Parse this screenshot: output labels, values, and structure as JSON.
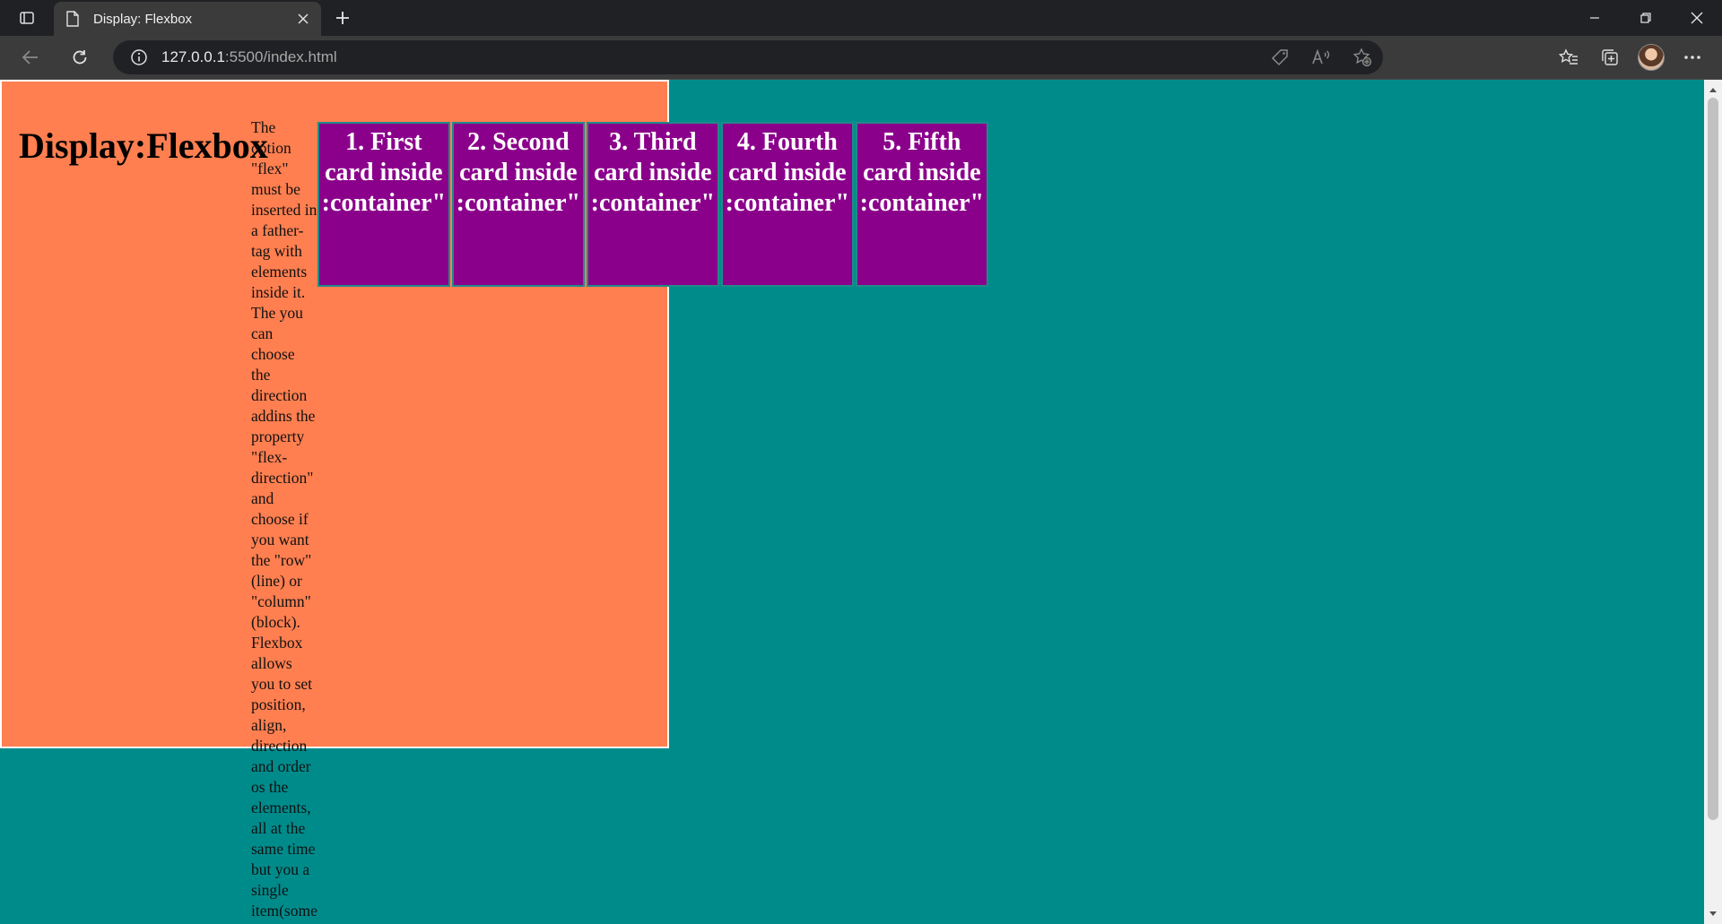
{
  "browser": {
    "tab_title": "Display: Flexbox",
    "url_host": "127.0.0.1",
    "url_rest": ":5500/index.html",
    "icons": {
      "tab_actions": "tab-actions-icon",
      "favicon": "page-icon",
      "tab_close": "close-icon",
      "new_tab": "plus-icon",
      "back": "back-arrow-icon",
      "refresh": "refresh-icon",
      "site_info": "info-icon",
      "addr": [
        "tag-icon",
        "read-aloud-icon",
        "add-favorite-icon"
      ],
      "toolbar": [
        "favorites-icon",
        "collections-icon",
        "avatar",
        "more-icon"
      ]
    }
  },
  "page": {
    "title": "Display:Flexbox",
    "description": "The option \"flex\" must be inserted in a father-tag with elements inside it. The you can choose the direction addins the property \"flex-direction\" and choose if you want the \"row\" (line) or \"column\" (block). Flexbox allows you to set position, align, direction and order os the elements, all at the same time but you a single item(some",
    "cards": [
      "1. First card inside :container\"",
      "2. Second card inside :container\"",
      "3. Third card inside :container\"",
      "4. Fourth card inside :container\"",
      "5. Fifth card inside :container\""
    ],
    "colors": {
      "body_bg": "#008b8b",
      "container_bg": "#ff7f50",
      "card_bg": "#8b008b",
      "card_text": "#ffffff"
    }
  }
}
